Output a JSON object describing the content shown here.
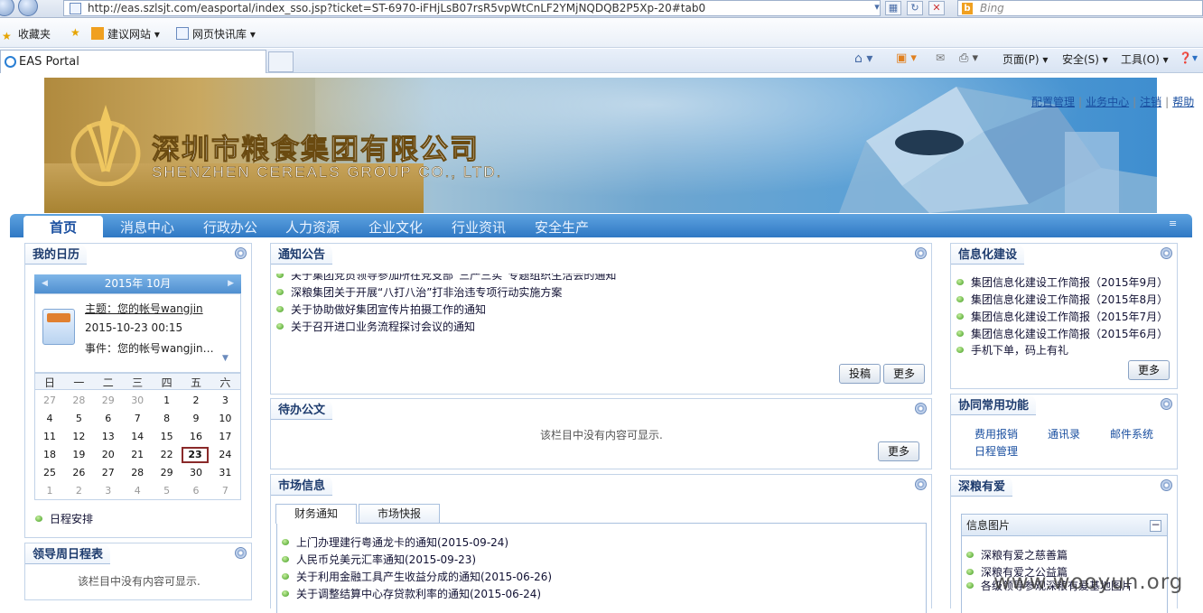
{
  "browser": {
    "url": "http://eas.szlsjt.com/easportal/index_sso.jsp?ticket=ST-6970-iFHjLsB07rsR5vpWtCnLF2YMjNQDQB2P5Xp-20#tab0",
    "search_placeholder": "Bing",
    "favorites_label": "收藏夹",
    "fav_items": [
      "建议网站",
      "网页快讯库"
    ],
    "tab_title": "EAS Portal",
    "cmd_page": "页面(P)",
    "cmd_safety": "安全(S)",
    "cmd_tools": "工具(O)"
  },
  "header": {
    "company_cn": "深圳市粮食集团有限公司",
    "company_en": "SHENZHEN CEREALS GROUP CO., LTD.",
    "links": [
      "配置管理",
      "业务中心",
      "注销",
      "帮助"
    ]
  },
  "nav": {
    "home": "首页",
    "items": [
      "消息中心",
      "行政办公",
      "人力资源",
      "企业文化",
      "行业资讯",
      "安全生产"
    ]
  },
  "calendar": {
    "title": "我的日历",
    "month_label": "2015年  10月",
    "event_subject": "主题：您的帐号wangjin",
    "event_time": "2015-10-23 00:15",
    "event_desc": "事件：您的帐号wangjin…",
    "weekdays": [
      "日",
      "一",
      "二",
      "三",
      "四",
      "五",
      "六"
    ],
    "weeks": [
      [
        "27",
        "28",
        "29",
        "30",
        "1",
        "2",
        "3"
      ],
      [
        "4",
        "5",
        "6",
        "7",
        "8",
        "9",
        "10"
      ],
      [
        "11",
        "12",
        "13",
        "14",
        "15",
        "16",
        "17"
      ],
      [
        "18",
        "19",
        "20",
        "21",
        "22",
        "23",
        "24"
      ],
      [
        "25",
        "26",
        "27",
        "28",
        "29",
        "30",
        "31"
      ],
      [
        "1",
        "2",
        "3",
        "4",
        "5",
        "6",
        "7"
      ]
    ],
    "today": "23",
    "schedule_link": "日程安排"
  },
  "leader_schedule": {
    "title": "领导周日程表",
    "empty": "该栏目中没有内容可显示."
  },
  "notices": {
    "title": "通知公告",
    "items": [
      "关于集团党员领导参加所在党支部“三严三实”专题组织生活会的通知",
      "深粮集团关于开展“八打八治”打非治违专项行动实施方案",
      "关于协助做好集团宣传片拍摄工作的通知",
      "关于召开进口业务流程探讨会议的通知"
    ],
    "submit_btn": "投稿",
    "more_btn": "更多"
  },
  "todo": {
    "title": "待办公文",
    "empty": "该栏目中没有内容可显示.",
    "more_btn": "更多"
  },
  "market": {
    "title": "市场信息",
    "tabs": [
      "财务通知",
      "市场快报"
    ],
    "items": [
      "上门办理建行粤通龙卡的通知(2015-09-24)",
      "人民币兑美元汇率通知(2015-09-23)",
      "关于利用金融工具产生收益分成的通知(2015-06-26)",
      "关于调整结算中心存贷款利率的通知(2015-06-24)"
    ]
  },
  "it": {
    "title": "信息化建设",
    "items": [
      "集团信息化建设工作简报（2015年9月）",
      "集团信息化建设工作简报（2015年8月）",
      "集团信息化建设工作简报（2015年7月）",
      "集团信息化建设工作简报（2015年6月）",
      "手机下单，码上有礼"
    ],
    "more_btn": "更多"
  },
  "collab": {
    "title": "协同常用功能",
    "links": [
      "费用报销",
      "通讯录",
      "邮件系统",
      "日程管理"
    ]
  },
  "love": {
    "title": "深粮有爱",
    "subtitle": "信息图片",
    "items": [
      "深粮有爱之慈善篇",
      "深粮有爱之公益篇",
      "各级领导参观深粮有爱基地图片"
    ]
  },
  "watermark": "www.wooyun.org"
}
